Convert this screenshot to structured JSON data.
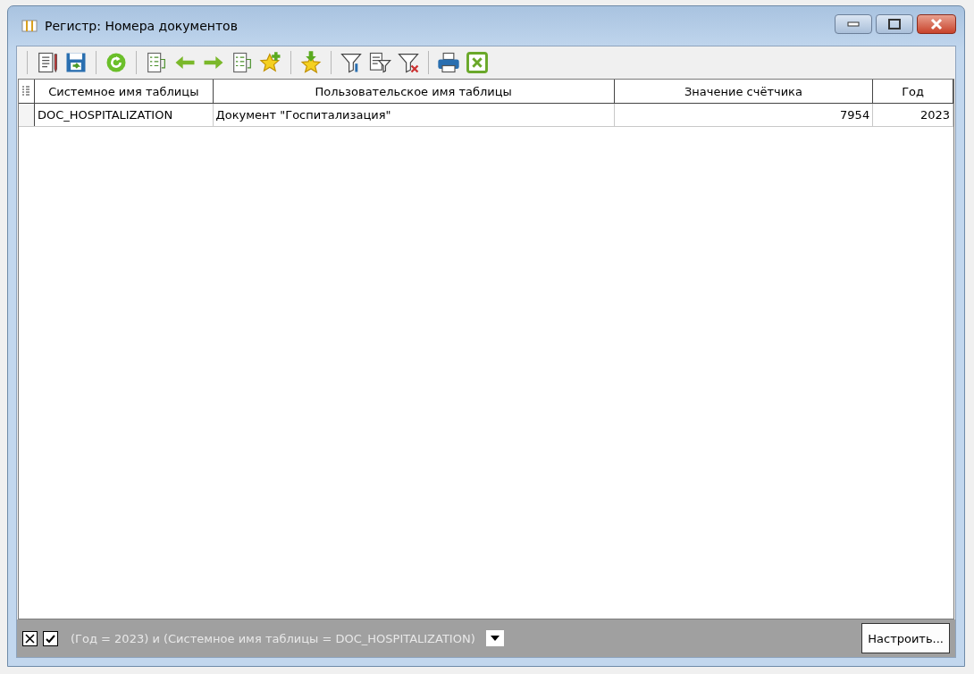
{
  "window": {
    "title": "Регистр: Номера документов"
  },
  "table": {
    "columns": [
      {
        "label": "Системное имя таблицы"
      },
      {
        "label": "Пользовательское имя таблицы"
      },
      {
        "label": "Значение счётчика"
      },
      {
        "label": "Год"
      }
    ],
    "rows": [
      [
        "DOC_HOSPITALIZATION",
        "Документ \"Госпитализация\"",
        "7954",
        "2023"
      ]
    ]
  },
  "filter_bar": {
    "enabled": true,
    "expression": "(Год  = 2023) и (Системное имя таблицы = DOC_HOSPITALIZATION)",
    "button": "Настроить..."
  }
}
